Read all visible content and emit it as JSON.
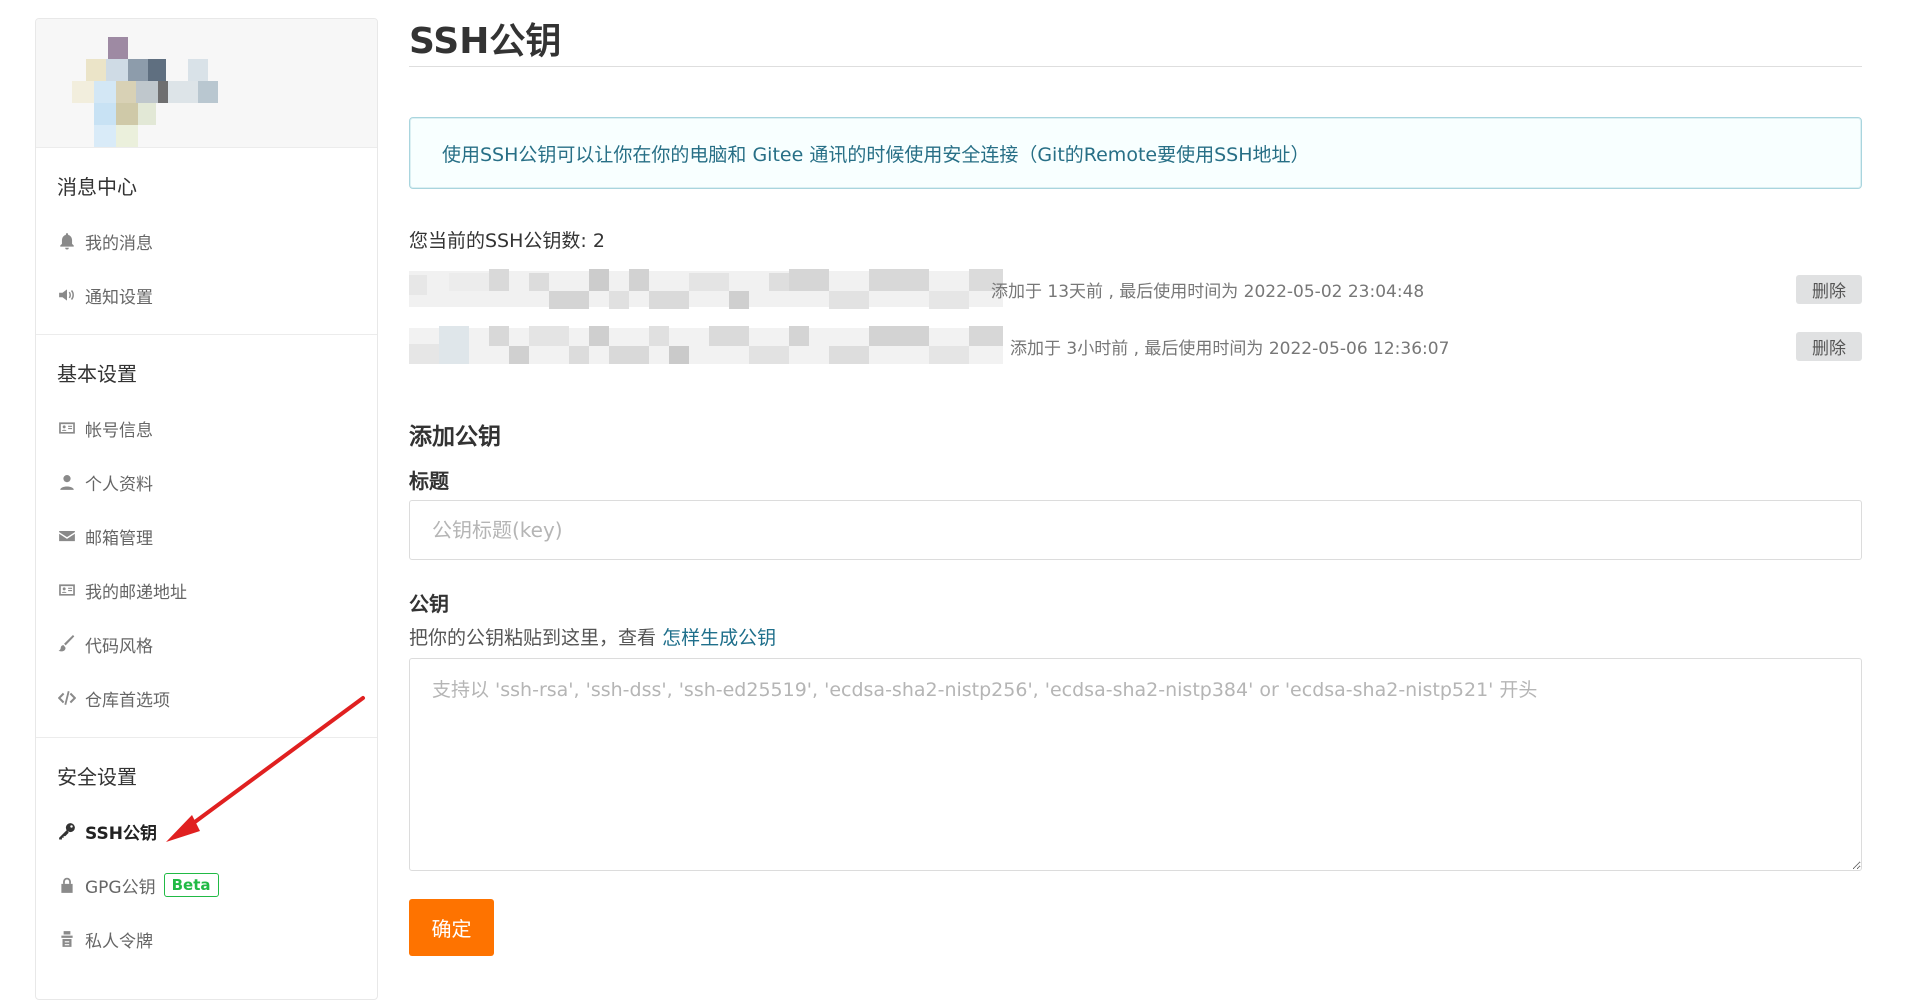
{
  "sidebar": {
    "sections": [
      {
        "title": "消息中心",
        "items": [
          {
            "label": "我的消息",
            "icon": "bell-icon"
          },
          {
            "label": "通知设置",
            "icon": "volume-icon"
          }
        ]
      },
      {
        "title": "基本设置",
        "items": [
          {
            "label": "帐号信息",
            "icon": "id-card-icon"
          },
          {
            "label": "个人资料",
            "icon": "user-icon"
          },
          {
            "label": "邮箱管理",
            "icon": "envelope-icon"
          },
          {
            "label": "我的邮递地址",
            "icon": "address-card-icon"
          },
          {
            "label": "代码风格",
            "icon": "paintbrush-icon"
          },
          {
            "label": "仓库首选项",
            "icon": "code-icon"
          }
        ]
      },
      {
        "title": "安全设置",
        "items": [
          {
            "label": "SSH公钥",
            "icon": "key-icon",
            "active": true
          },
          {
            "label": "GPG公钥",
            "icon": "lock-icon",
            "badge": "Beta"
          },
          {
            "label": "私人令牌",
            "icon": "token-icon"
          }
        ]
      }
    ]
  },
  "main": {
    "title": "SSH公钥",
    "info": "使用SSH公钥可以让你在你的电脑和 Gitee 通讯的时候使用安全连接（Git的Remote要使用SSH地址）",
    "key_count_text": "您当前的SSH公钥数: 2",
    "keys": [
      {
        "meta": "添加于 13天前 , 最后使用时间为 2022-05-02 23:04:48",
        "delete_label": "删除"
      },
      {
        "meta": "添加于 3小时前 , 最后使用时间为 2022-05-06 12:36:07",
        "delete_label": "删除"
      }
    ],
    "add_title": "添加公钥",
    "title_label": "标题",
    "title_placeholder": "公钥标题(key)",
    "key_label": "公钥",
    "key_hint": "把你的公钥粘贴到这里，查看",
    "key_hint_link": "怎样生成公钥",
    "key_placeholder": "支持以 'ssh-rsa', 'ssh-dss', 'ssh-ed25519', 'ecdsa-sha2-nistp256', 'ecdsa-sha2-nistp384' or 'ecdsa-sha2-nistp521' 开头",
    "submit_label": "确定"
  },
  "colors": {
    "accent": "#fe7300",
    "info_text": "#276f86",
    "info_border": "#a9d5de",
    "badge": "#21ba45",
    "arrow": "#e02020"
  }
}
